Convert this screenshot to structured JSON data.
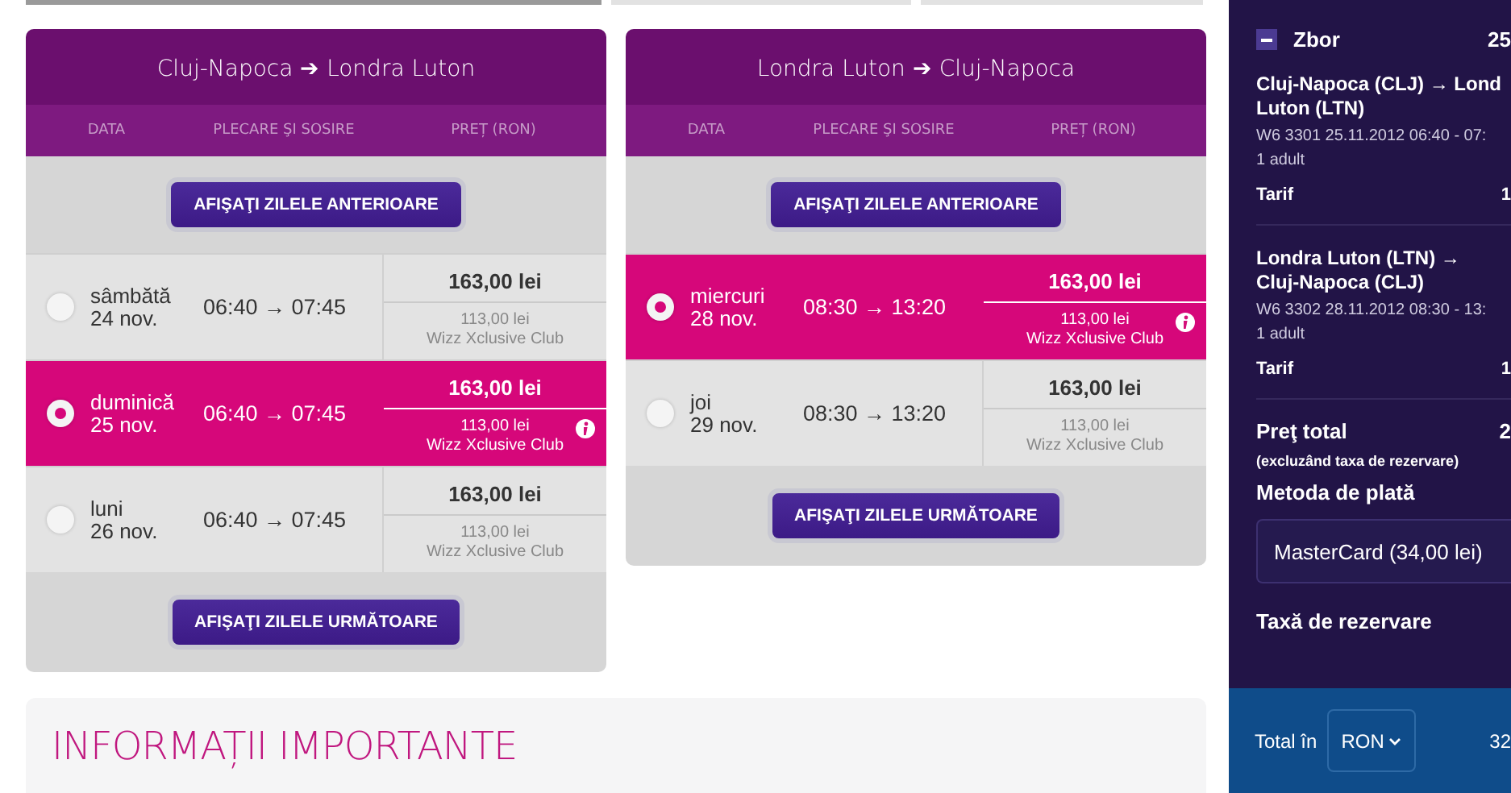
{
  "top_tabs": [
    {
      "selected": true
    },
    {
      "selected": false
    },
    {
      "selected": false
    }
  ],
  "flights": [
    {
      "title": "Cluj-Napoca ➔ Londra Luton",
      "columns": [
        "DATA",
        "PLECARE ŞI SOSIRE",
        "PREȚ (RON)"
      ],
      "prev_button": "AFIŞAŢI ZILELE ANTERIOARE",
      "next_button": "AFIŞAŢI ZILELE URMĂTOARE",
      "days": [
        {
          "day": "sâmbătă",
          "date": "24 nov.",
          "times": "06:40 → 07:45",
          "price": "163,00 lei",
          "club_price": "113,00 lei",
          "club_label": "Wizz Xclusive Club",
          "selected": false
        },
        {
          "day": "duminică",
          "date": "25 nov.",
          "times": "06:40 → 07:45",
          "price": "163,00 lei",
          "club_price": "113,00 lei",
          "club_label": "Wizz Xclusive Club",
          "selected": true
        },
        {
          "day": "luni",
          "date": "26 nov.",
          "times": "06:40 → 07:45",
          "price": "163,00 lei",
          "club_price": "113,00 lei",
          "club_label": "Wizz Xclusive Club",
          "selected": false
        }
      ]
    },
    {
      "title": "Londra Luton ➔ Cluj-Napoca",
      "columns": [
        "DATA",
        "PLECARE ŞI SOSIRE",
        "PREȚ (RON)"
      ],
      "prev_button": "AFIŞAŢI ZILELE ANTERIOARE",
      "next_button": "AFIŞAŢI ZILELE URMĂTOARE",
      "days": [
        {
          "day": "miercuri",
          "date": "28 nov.",
          "times": "08:30 → 13:20",
          "price": "163,00 lei",
          "club_price": "113,00 lei",
          "club_label": "Wizz Xclusive Club",
          "selected": true
        },
        {
          "day": "joi",
          "date": "29 nov.",
          "times": "08:30 → 13:20",
          "price": "163,00 lei",
          "club_price": "113,00 lei",
          "club_label": "Wizz Xclusive Club",
          "selected": false
        }
      ]
    }
  ],
  "info": {
    "title": "INFORMAȚII IMPORTANTE"
  },
  "summary": {
    "section": {
      "label": "Zbor",
      "amount": "25",
      "expanded": true
    },
    "legs": [
      {
        "route_lines": [
          "Cluj-Napoca (CLJ) → Lond",
          "Luton (LTN)"
        ],
        "flight": "W6 3301  25.11.2012 06:40 - 07:",
        "passengers": "1 adult",
        "fare_label": "Tarif",
        "fare": "1"
      },
      {
        "route_lines": [
          "Londra Luton (LTN) →",
          "Cluj-Napoca (CLJ)"
        ],
        "flight": "W6 3302  28.11.2012 08:30 - 13:",
        "passengers": "1 adult",
        "fare_label": "Tarif",
        "fare": "1"
      }
    ],
    "total_label": "Preţ total",
    "total_value": "2",
    "total_note": "(excluzând taxa de rezervare)",
    "payment_label": "Metoda de plată",
    "payment_value": "MasterCard (34,00 lei)",
    "fee_label": "Taxă de rezervare",
    "footer": {
      "label": "Total în",
      "currency": "RON",
      "amount": "32"
    }
  }
}
